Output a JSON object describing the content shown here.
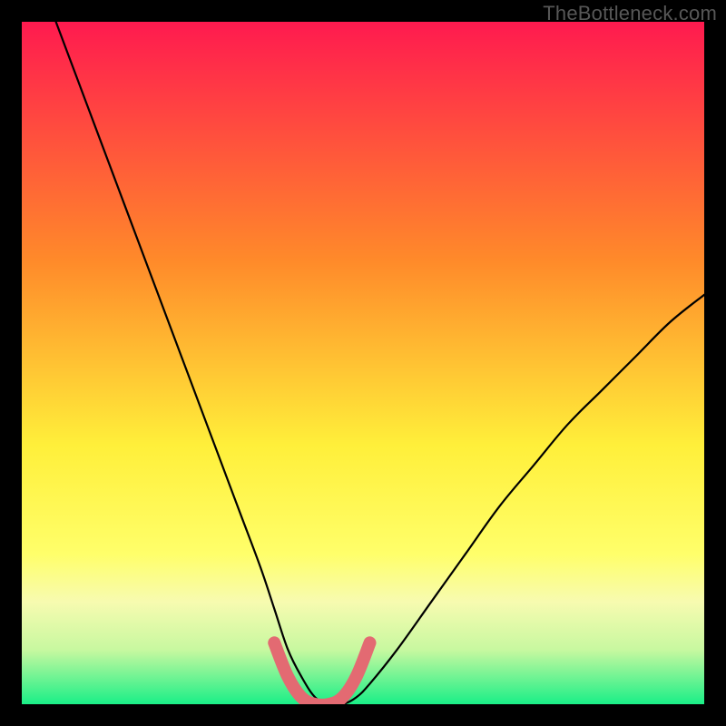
{
  "watermark": "TheBottleneck.com",
  "colors": {
    "background_black": "#000000",
    "curve_black": "#000000",
    "bottom_pink": "#e36a72",
    "gradient_top": "#ff1a4f",
    "gradient_mid_orange": "#ff9a2a",
    "gradient_yellow": "#ffef3a",
    "gradient_pale": "#f7fbb0",
    "gradient_green": "#1aef87"
  },
  "chart_data": {
    "type": "line",
    "title": "",
    "xlabel": "",
    "ylabel": "",
    "xlim": [
      0,
      100
    ],
    "ylim": [
      0,
      100
    ],
    "series": [
      {
        "name": "bottleneck-curve",
        "x": [
          5,
          8,
          11,
          14,
          17,
          20,
          23,
          26,
          29,
          32,
          35,
          37,
          39,
          41,
          43,
          45,
          47,
          49,
          51,
          55,
          60,
          65,
          70,
          75,
          80,
          85,
          90,
          95,
          100
        ],
        "y": [
          100,
          92,
          84,
          76,
          68,
          60,
          52,
          44,
          36,
          28,
          20,
          14,
          8,
          4,
          1,
          0,
          0,
          1,
          3,
          8,
          15,
          22,
          29,
          35,
          41,
          46,
          51,
          56,
          60
        ]
      },
      {
        "name": "bottom-u-overlay",
        "x": [
          37,
          39,
          41,
          43,
          45,
          47,
          49,
          51
        ],
        "y": [
          9,
          4,
          1,
          0,
          0,
          1,
          4,
          9
        ]
      }
    ],
    "gradient_stops": [
      {
        "offset": 0.0,
        "color": "#ff1a4f"
      },
      {
        "offset": 0.35,
        "color": "#ff8a2a"
      },
      {
        "offset": 0.62,
        "color": "#ffef3a"
      },
      {
        "offset": 0.78,
        "color": "#ffff6a"
      },
      {
        "offset": 0.85,
        "color": "#f7fbb0"
      },
      {
        "offset": 0.92,
        "color": "#c8f8a0"
      },
      {
        "offset": 1.0,
        "color": "#1aef87"
      }
    ]
  }
}
